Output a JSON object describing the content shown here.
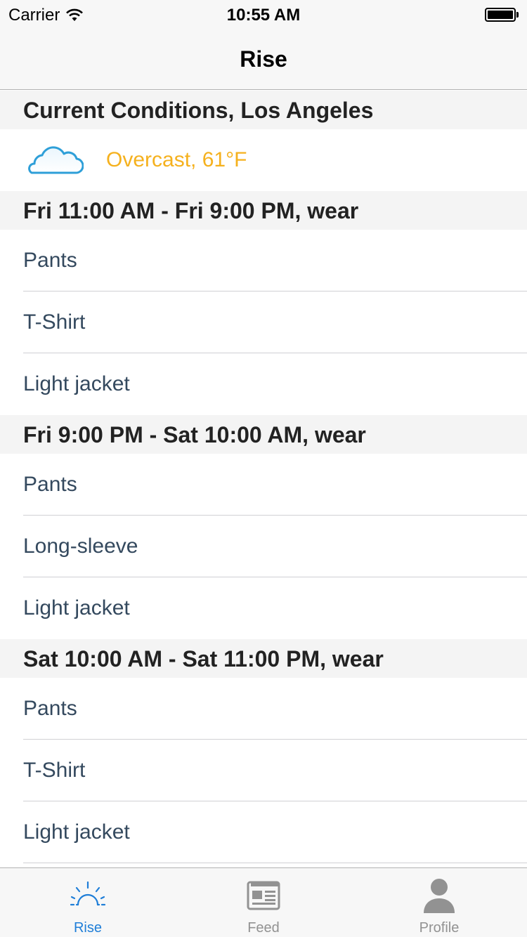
{
  "status_bar": {
    "carrier": "Carrier",
    "time": "10:55 AM"
  },
  "nav": {
    "title": "Rise"
  },
  "current": {
    "header": "Current Conditions, Los Angeles",
    "icon": "cloud-icon",
    "conditions": "Overcast, 61°F",
    "accent_color": "#f5b11e"
  },
  "sections": [
    {
      "header": "Fri 11:00 AM - Fri 9:00 PM, wear",
      "items": [
        "Pants",
        "T-Shirt",
        "Light jacket"
      ]
    },
    {
      "header": "Fri 9:00 PM - Sat 10:00 AM, wear",
      "items": [
        "Pants",
        "Long-sleeve",
        "Light jacket"
      ]
    },
    {
      "header": "Sat 10:00 AM - Sat 11:00 PM, wear",
      "items": [
        "Pants",
        "T-Shirt",
        "Light jacket"
      ]
    }
  ],
  "tabs": [
    {
      "label": "Rise",
      "icon": "sunrise-icon",
      "active": true
    },
    {
      "label": "Feed",
      "icon": "newspaper-icon",
      "active": false
    },
    {
      "label": "Profile",
      "icon": "person-icon",
      "active": false
    }
  ],
  "colors": {
    "active_tab": "#1f7ed8",
    "inactive_tab": "#929292",
    "item_text": "#34495e"
  }
}
